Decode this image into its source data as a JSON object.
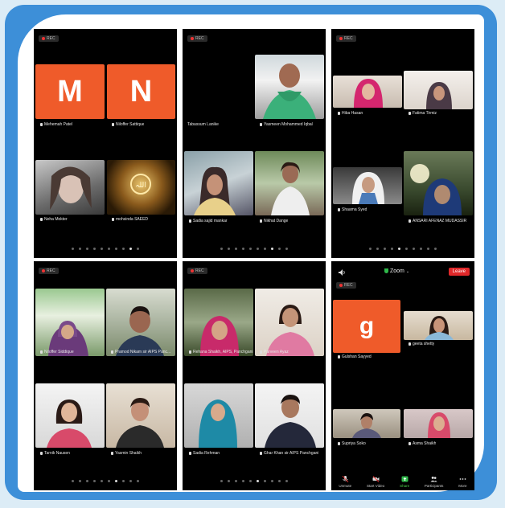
{
  "rec_label": "REC",
  "screens": [
    {
      "tiles": [
        {
          "letter": "M",
          "name": "Mehemah Patel"
        },
        {
          "letter": "N",
          "name": "Niloffer Sattique"
        },
        {
          "name": "Neha Mokter"
        },
        {
          "name": "mohsinda SAEED"
        }
      ]
    },
    {
      "tiles": [
        {
          "name": "Tabassum Lanike"
        },
        {
          "name": "Yasmeen Mohammed Iqbal"
        },
        {
          "name": "Sadia sajid mankar"
        },
        {
          "name": "Nikhat Dange"
        }
      ]
    },
    {
      "tiles": [
        {
          "name": "Hiba Hasan"
        },
        {
          "name": "Fatima Tirmiz"
        },
        {
          "name": "Shaama Syed"
        },
        {
          "name": "ANSARI AFENAZ MUDASSIR"
        }
      ]
    },
    {
      "tiles": [
        {
          "name": "Niloffer Siddique"
        },
        {
          "name": "Pramod Nikam sir AIPS Panc..."
        },
        {
          "name": "Tarnik Nausen"
        },
        {
          "name": "Yasmin Shaikh"
        }
      ]
    },
    {
      "tiles": [
        {
          "name": "Rehana Shaikh, AIPS, Panchgani"
        },
        {
          "name": "Parveen Ayaz"
        },
        {
          "name": "Sadia Rehman"
        },
        {
          "name": "Ghar Khan sir AIPS Panchgani"
        }
      ]
    },
    {
      "zoom_title": "Zoom",
      "leave_label": "Leave",
      "tiles": [
        {
          "letter": "g",
          "name": "Gulshan Sayyed"
        },
        {
          "name": "geeta shetty"
        },
        {
          "name": "Supriya Soko"
        },
        {
          "name": "Asma Shaikh"
        }
      ],
      "toolbar": [
        "Unmute",
        "Start Video",
        "Share",
        "Participants",
        "More"
      ]
    }
  ]
}
